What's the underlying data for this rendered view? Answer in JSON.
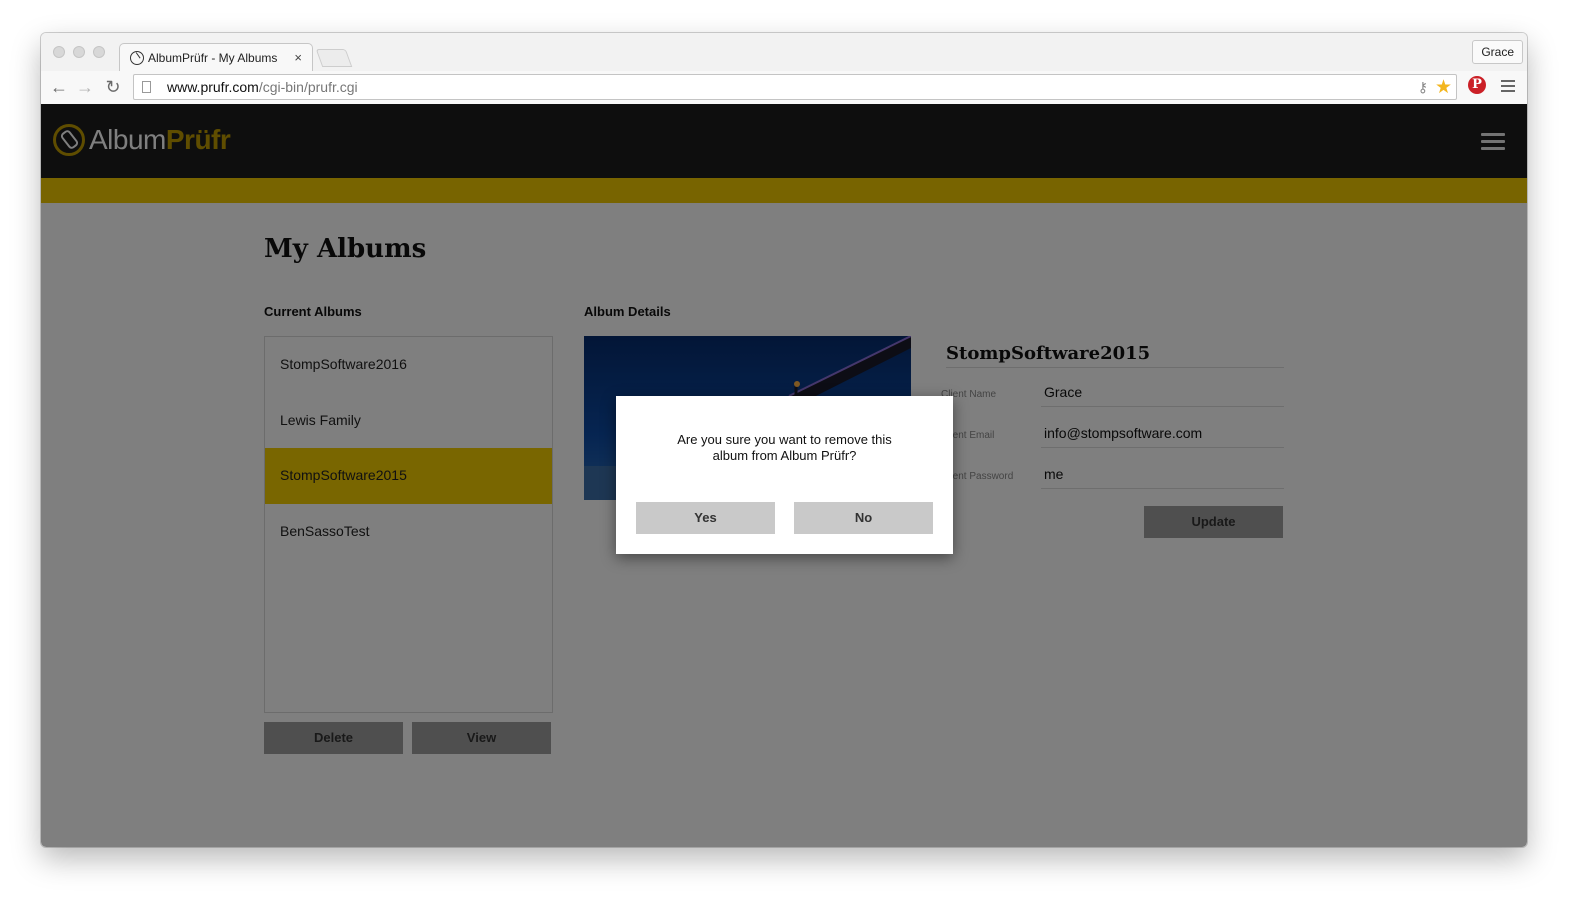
{
  "browser": {
    "tab_title": "AlbumPrüfr - My Albums",
    "tab_close": "×",
    "profile_name": "Grace",
    "url_host": "www.prufr.com",
    "url_path": "/cgi-bin/prufr.cgi",
    "back_glyph": "←",
    "forward_glyph": "→",
    "reload_glyph": "↻",
    "pinterest_glyph": "P"
  },
  "site": {
    "logo_part1": "Album",
    "logo_part2": "Prüfr",
    "brand_color": "#f0c900"
  },
  "page": {
    "title": "My Albums",
    "current_albums_label": "Current Albums",
    "album_details_label": "Album Details",
    "albums": [
      {
        "name": "StompSoftware2016",
        "selected": false
      },
      {
        "name": "Lewis Family",
        "selected": false
      },
      {
        "name": "StompSoftware2015",
        "selected": true
      },
      {
        "name": "BenSassoTest",
        "selected": false
      }
    ],
    "delete_label": "Delete",
    "view_label": "View"
  },
  "details": {
    "album_name": "StompSoftware2015",
    "client_name_label": "Client Name",
    "client_name": "Grace",
    "client_email_label": "Client Email",
    "client_email": "info@stompsoftware.com",
    "client_password_label": "Client Password",
    "client_password": "me",
    "update_label": "Update"
  },
  "dialog": {
    "message": "Are you sure you want to remove this album from Album Prüfr?",
    "yes_label": "Yes",
    "no_label": "No"
  }
}
